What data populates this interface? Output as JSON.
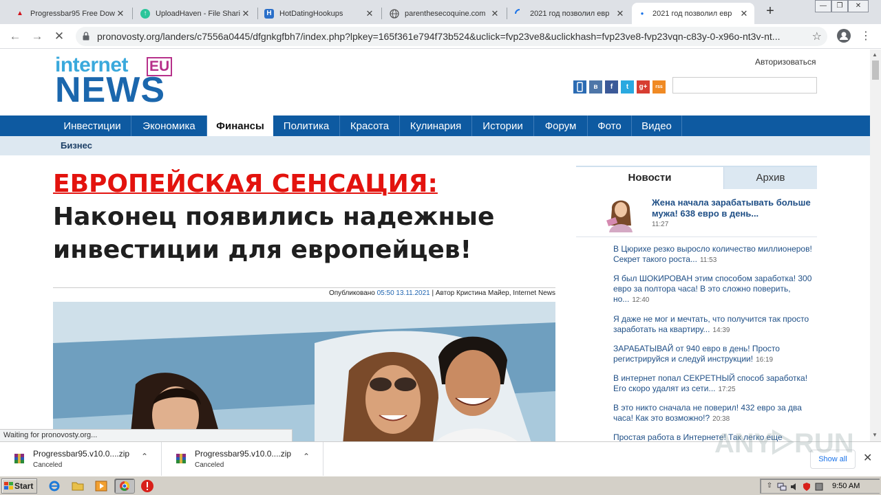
{
  "browser": {
    "tabs": [
      {
        "title": "Progressbar95 Free Dow",
        "favicon": "adobe-icon"
      },
      {
        "title": "UploadHaven - File Shari",
        "favicon": "uploadhaven-icon"
      },
      {
        "title": "HotDatingHookups",
        "favicon": "h-icon"
      },
      {
        "title": "parenthesecoquine.com",
        "favicon": "globe-icon"
      },
      {
        "title": "2021 год позволил евр",
        "favicon": "loading-icon"
      },
      {
        "title": "2021 год позволил евр",
        "favicon": "loading-dot-icon",
        "active": true
      }
    ],
    "url": "pronovosty.org/landers/c7556a0445/dfgnkgfbh7/index.php?lpkey=165f361e794f73b524&uclick=fvp23ve8&uclickhash=fvp23ve8-fvp23vqn-c83y-0-x96o-nt3v-nt...",
    "status_text": "Waiting for pronovosty.org..."
  },
  "site": {
    "logo_top": "internet",
    "logo_badge": "EU",
    "logo_main": "NEWS",
    "login_link": "Авторизоваться",
    "social": [
      {
        "icon": "mobile-icon",
        "color": "#2b6bb3"
      },
      {
        "icon": "vk-icon",
        "label": "в",
        "color": "#4e76a8"
      },
      {
        "icon": "facebook-icon",
        "label": "f",
        "color": "#3b5998"
      },
      {
        "icon": "twitter-icon",
        "label": "t",
        "color": "#2aa9e0"
      },
      {
        "icon": "google-plus-icon",
        "label": "g+",
        "color": "#d73d32"
      },
      {
        "icon": "rss-icon",
        "label": "rss",
        "color": "#f08a24"
      }
    ],
    "nav": [
      {
        "label": "Инвестиции"
      },
      {
        "label": "Экономика"
      },
      {
        "label": "Финансы",
        "active": true
      },
      {
        "label": "Политика"
      },
      {
        "label": "Красота"
      },
      {
        "label": "Кулинария"
      },
      {
        "label": "Истории"
      },
      {
        "label": "Форум"
      },
      {
        "label": "Фото"
      },
      {
        "label": "Видео"
      }
    ],
    "subnav": "Бизнес",
    "accent_color": "#0e5aa1"
  },
  "article": {
    "headline_red": "ЕВРОПЕЙСКАЯ СЕНСАЦИЯ:",
    "headline_rest": " Наконец появились надежные инвестиции для европейцев!",
    "byline_prefix": "Опубликовано ",
    "byline_time": "05:50 13.11.2021",
    "byline_suffix": " | Автор Кристина Майер, Internet News"
  },
  "sidebar": {
    "tab_news": "Новости",
    "tab_archive": "Архив",
    "featured": {
      "title": "Жена начала зарабатывать больше мужа! 638 евро в день...",
      "time": "11:27"
    },
    "items": [
      {
        "text": "В Цюрихе резко выросло количество миллионеров! Секрет такого роста...",
        "time": "11:53"
      },
      {
        "text": "Я был ШОКИРОВАН этим способом заработка! 300 евро за полтора часа! В это сложно поверить, но...",
        "time": "12:40"
      },
      {
        "text": "Я даже не мог и мечтать, что получится так просто заработать на квартиру...",
        "time": "14:39"
      },
      {
        "text": "ЗАРАБАТЫВАЙ от 940 евро в день! Просто регистрируйся и следуй инструкции!",
        "time": "16:19"
      },
      {
        "text": "В интернет попал СЕКРЕТНЫЙ способ заработка! Его скоро удалят из сети...",
        "time": "17:25"
      },
      {
        "text": "В это никто сначала не поверил! 432 евро за два часа! Как это возможно!?",
        "time": "20:38"
      },
      {
        "text": "Простая работа в Интернете! Так легко еще",
        "time": ""
      }
    ]
  },
  "downloads": {
    "items": [
      {
        "name": "Progressbar95.v10.0....zip",
        "status": "Canceled"
      },
      {
        "name": "Progressbar95.v10.0....zip",
        "status": "Canceled"
      }
    ],
    "show_all": "Show all"
  },
  "taskbar": {
    "start": "Start",
    "clock": "9:50 AM"
  }
}
